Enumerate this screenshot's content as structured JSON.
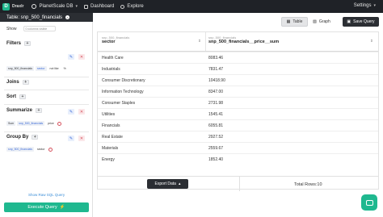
{
  "topbar": {
    "logo_letter": "D",
    "logo_text": "Draxlr",
    "database": "PlanetScale DB",
    "nav": [
      "Dashboard",
      "Explore"
    ],
    "settings": "Settings"
  },
  "sidebar": {
    "table_label": "Table: snp_500_financials",
    "show_label": "Show",
    "show_placeholder": "0 columns visible",
    "filters_title": "Filters",
    "filter_chips": [
      "snp_500_financials",
      "sector",
      "not like",
      "%"
    ],
    "joins_title": "Joins",
    "sort_title": "Sort",
    "summarize_title": "Summarize",
    "summarize_chips": [
      "Sum",
      "snp_500_financials",
      "price"
    ],
    "group_title": "Group By",
    "group_chips": [
      "snp_500_financials",
      "sector"
    ],
    "show_sql": "Show Raw SQL Query",
    "execute": "Execute Query"
  },
  "main": {
    "table_btn": "Table",
    "graph_btn": "Graph",
    "save_btn": "Save Query",
    "col1_sub": "snp_500_financials",
    "col1_name": "sector",
    "col2_sub": "snp_500_financials",
    "col2_name": "snp_500_financials__price__sum",
    "rows": [
      [
        "Health Care",
        "8083.46"
      ],
      [
        "Industrials",
        "7831.47"
      ],
      [
        "Consumer Discretionary",
        "10418.90"
      ],
      [
        "Information Technology",
        "8347.00"
      ],
      [
        "Consumer Staples",
        "2731.98"
      ],
      [
        "Utilities",
        "1545.41"
      ],
      [
        "Financials",
        "6055.81"
      ],
      [
        "Real Estate",
        "2927.52"
      ],
      [
        "Materials",
        "2559.67"
      ],
      [
        "Energy",
        "1852.40"
      ]
    ],
    "export": "Export Data",
    "total": "Total Rows:10"
  }
}
